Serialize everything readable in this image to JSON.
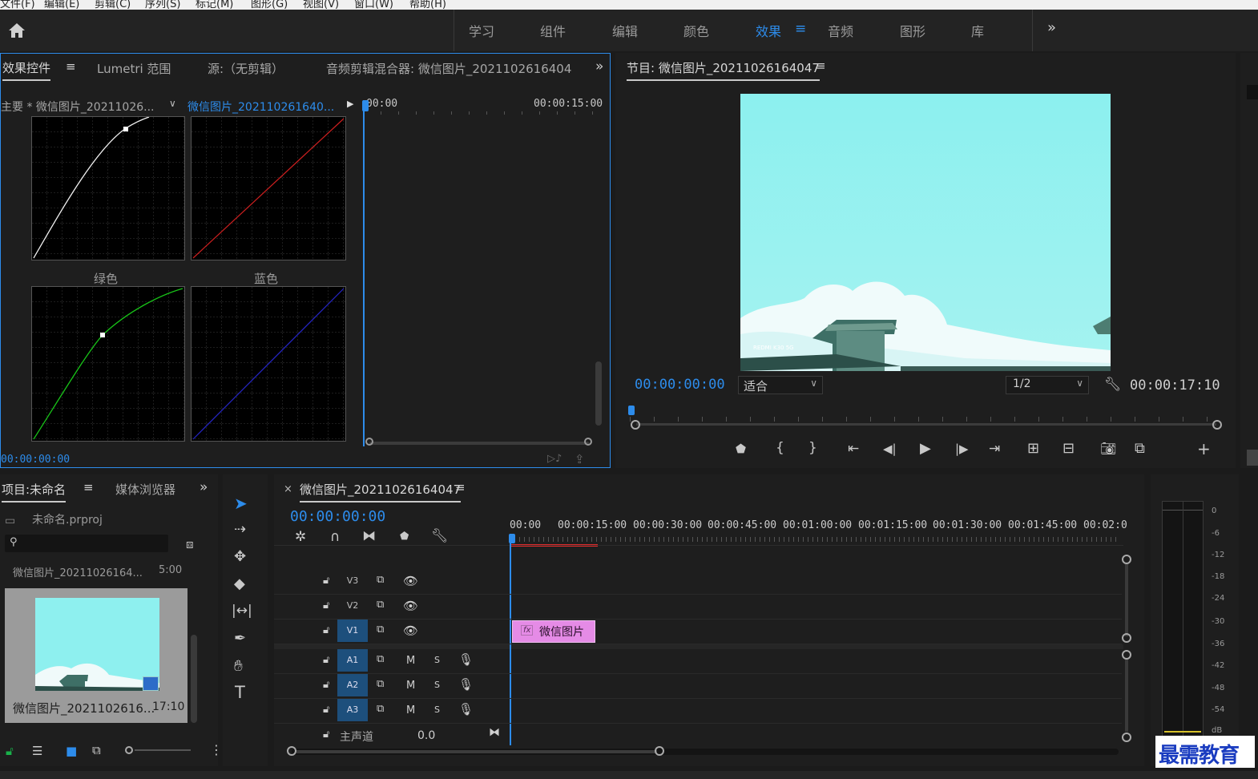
{
  "menu": [
    "文件(F)",
    "编辑(E)",
    "剪辑(C)",
    "序列(S)",
    "标记(M)",
    "图形(G)",
    "视图(V)",
    "窗口(W)",
    "帮助(H)"
  ],
  "workspaces": [
    "学习",
    "组件",
    "编辑",
    "颜色",
    "效果",
    "音频",
    "图形",
    "库"
  ],
  "workspace_active": "效果",
  "effects_panel": {
    "tabs": [
      "效果控件",
      "Lumetri 范围",
      "源:（无剪辑）",
      "音频剪辑混合器: 微信图片_2021102616404"
    ],
    "master_clip": "主要 * 微信图片_20211026...",
    "active_clip": "微信图片_202110261640...",
    "ruler_start": "00:00",
    "ruler_end": "00:00:15:00",
    "curve_green_label": "绿色",
    "curve_blue_label": "蓝色",
    "timecode": "00:00:00:00"
  },
  "program_monitor": {
    "title": "节目: 微信图片_20211026164047",
    "timecode": "00:00:00:00",
    "fit": "适合",
    "resolution": "1/2",
    "duration": "00:00:17:10",
    "watermark": "REDMI K30 5G"
  },
  "project_panel": {
    "tabs": [
      "项目:未命名",
      "媒体浏览器"
    ],
    "file": "未命名.prproj",
    "item_top_name": "微信图片_20211026164...",
    "item_top_dur": "5:00",
    "item_name": "微信图片_2021102616...",
    "item_dur": "17:10"
  },
  "timeline": {
    "title": "微信图片_20211026164047",
    "timecode": "00:00:00:00",
    "ruler": [
      "00:00",
      "00:00:15:00",
      "00:00:30:00",
      "00:00:45:00",
      "00:01:00:00",
      "00:01:15:00",
      "00:01:30:00",
      "00:01:45:00",
      "00:02:0"
    ],
    "tracks_video": [
      "V3",
      "V2",
      "V1"
    ],
    "tracks_audio": [
      "A1",
      "A2",
      "A3"
    ],
    "mute": "M",
    "solo": "S",
    "master_label": "主声道",
    "master_value": "0.0",
    "clip_label": "微信图片"
  },
  "audio_meter": {
    "ticks": [
      "0",
      "-6",
      "-12",
      "-18",
      "-24",
      "-30",
      "-36",
      "-42",
      "-48",
      "-54",
      "dB"
    ]
  },
  "brand_logo": "最需教育",
  "colors": {
    "accent": "#2d8ceb",
    "clip": "#e58be6",
    "sky": "#8ef0ef"
  }
}
